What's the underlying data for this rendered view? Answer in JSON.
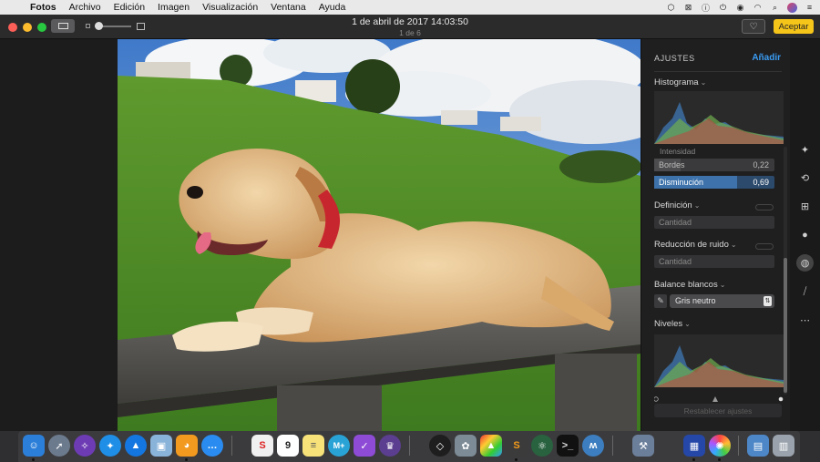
{
  "menubar": {
    "items": [
      "Fotos",
      "Archivo",
      "Edición",
      "Imagen",
      "Visualización",
      "Ventana",
      "Ayuda"
    ],
    "status_icons": [
      "dropbox-icon",
      "close-box-icon",
      "info-icon",
      "power-icon",
      "shield-icon",
      "wifi-icon",
      "search-icon",
      "avatar",
      "list-icon"
    ]
  },
  "toolbar": {
    "title": "1 de abril de 2017 14:03:50",
    "subtitle": "1 de 6",
    "favorite_glyph": "♡",
    "accept_label": "Aceptar"
  },
  "panel": {
    "header": "AJUSTES",
    "add_label": "Añadir",
    "histogram_label": "Histograma",
    "cut_label": "Intensidad",
    "sliders": [
      {
        "label": "Bordes",
        "value": "0,22",
        "fill": 0.22,
        "active": false
      },
      {
        "label": "Disminución",
        "value": "0,69",
        "fill": 0.69,
        "active": true
      }
    ],
    "definition_label": "Definición",
    "definition_field": "Cantidad",
    "noise_label": "Reducción de ruido",
    "noise_field": "Cantidad",
    "wb_label": "Balance blancos",
    "wb_value": "Gris neutro",
    "levels_label": "Niveles",
    "reset_label": "Restablecer ajustes"
  },
  "tools": [
    "magic-wand-icon",
    "rotate-icon",
    "crop-icon",
    "filters-icon",
    "adjust-icon",
    "retouch-icon",
    "more-icon"
  ],
  "dock": [
    "finder",
    "launchpad",
    "safari-alt",
    "safari",
    "pilot",
    "preview",
    "lion",
    "messages",
    "sketch",
    "calendar",
    "notes",
    "mplus",
    "omnifocus",
    "alfred",
    "codekit",
    "gas-mask",
    "colorsync",
    "sublime",
    "atom",
    "terminal",
    "ceramic",
    "xcode-tools",
    "iphoto-upload",
    "photos",
    "folder",
    "trash"
  ],
  "colors": {
    "accent": "#3a9cf3",
    "accept": "#f6c51a"
  }
}
